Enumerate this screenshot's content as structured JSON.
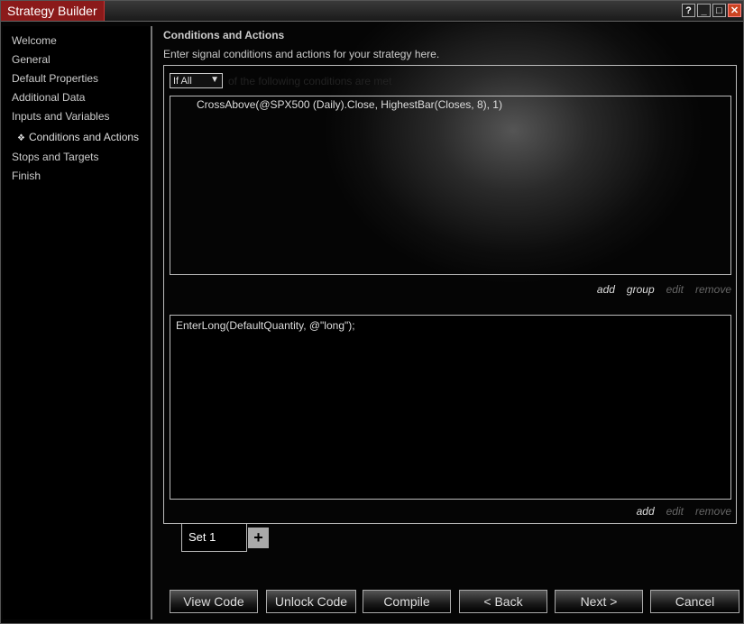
{
  "window": {
    "title": "Strategy Builder",
    "buttons": [
      "?",
      "_",
      "□",
      "✕"
    ]
  },
  "sidebar": {
    "items": [
      {
        "label": "Welcome"
      },
      {
        "label": "General"
      },
      {
        "label": "Default Properties"
      },
      {
        "label": "Additional Data"
      },
      {
        "label": "Inputs and Variables"
      },
      {
        "label": "Conditions and Actions",
        "active": true,
        "marker": "❖"
      },
      {
        "label": "Stops and Targets"
      },
      {
        "label": "Finish"
      }
    ]
  },
  "main": {
    "header": "Conditions and Actions",
    "subtitle": "Enter signal conditions and actions for your strategy here.",
    "conditions": {
      "selector_value": "If All",
      "label": "of the following conditions are met",
      "items": [
        "CrossAbove(@SPX500 (Daily).Close, HighestBar(Closes, 8), 1)"
      ],
      "links": {
        "add": "add",
        "group": "group",
        "edit": "edit",
        "remove": "remove"
      }
    },
    "actions": {
      "items": [
        "EnterLong(DefaultQuantity, @\"long\");"
      ],
      "links": {
        "add": "add",
        "edit": "edit",
        "remove": "remove"
      }
    },
    "tabs": [
      {
        "label": "Set 1"
      }
    ],
    "add_tab": "+"
  },
  "footer": {
    "view_code": "View Code",
    "unlock_code": "Unlock Code",
    "compile": "Compile",
    "back": "< Back",
    "next": "Next >",
    "cancel": "Cancel"
  }
}
